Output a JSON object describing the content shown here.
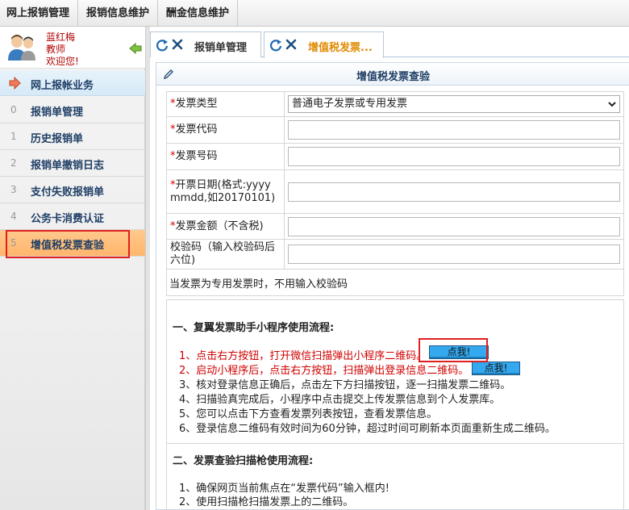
{
  "top_menu": [
    "网上报销管理",
    "报销信息维护",
    "酬金信息维护"
  ],
  "user": {
    "name": "蓝红梅",
    "role": "教师",
    "welcome": "欢迎您!"
  },
  "sidebar": {
    "section": "网上报帐业务",
    "items": [
      {
        "num": "0",
        "label": "报销单管理"
      },
      {
        "num": "1",
        "label": "历史报销单"
      },
      {
        "num": "2",
        "label": "报销单撤销日志"
      },
      {
        "num": "3",
        "label": "支付失败报销单"
      },
      {
        "num": "4",
        "label": "公务卡消费认证"
      },
      {
        "num": "5",
        "label": "增值税发票查验"
      }
    ]
  },
  "tabs": [
    {
      "label": "报销单管理"
    },
    {
      "label": "增值税发票..."
    }
  ],
  "panel": {
    "title": "增值税发票查验"
  },
  "form": {
    "invoice_type": {
      "req": "*",
      "label": "发票类型",
      "value": "普通电子发票或专用发票"
    },
    "invoice_code": {
      "req": "*",
      "label": "发票代码"
    },
    "invoice_number": {
      "req": "*",
      "label": "发票号码"
    },
    "invoice_date": {
      "req": "*",
      "label": "开票日期(格式:yyyymmdd,如20170101)"
    },
    "amount": {
      "req": "*",
      "label": "发票金额（不含税)"
    },
    "check_code": {
      "label": "校验码（输入校验码后六位)"
    },
    "warning": "当发票为专用发票时，不用输入校验码"
  },
  "section1": {
    "title": "一、复翼发票助手小程序使用流程:",
    "lines": [
      "1、点击右方按钮，打开微信扫描弹出小程序二维码。",
      "2、启动小程序后，点击右方按钮，扫描弹出登录信息二维码。",
      "3、核对登录信息正确后，点击左下方扫描按钮，逐一扫描发票二维码。",
      "4、扫描验真完成后，小程序中点击提交上传发票信息到个人发票库。",
      "5、您可以点击下方查看发票列表按钮，查看发票信息。",
      "6、登录信息二维码有效时间为60分钟，超过时间可刷新本页面重新生成二维码。"
    ],
    "button1": "点我!",
    "button2": "点我!"
  },
  "section2": {
    "title": "二、发票查验扫描枪使用流程:",
    "lines": [
      "1、确保网页当前焦点在“发票代码”输入框内!",
      "2、使用扫描枪扫描发票上的二维码。"
    ]
  },
  "colors": {
    "required": "#d00000",
    "active_tab": "#e08a00",
    "active_item": "#ffb56b",
    "button": "#35a9ef",
    "highlight_box": "#e02020"
  }
}
